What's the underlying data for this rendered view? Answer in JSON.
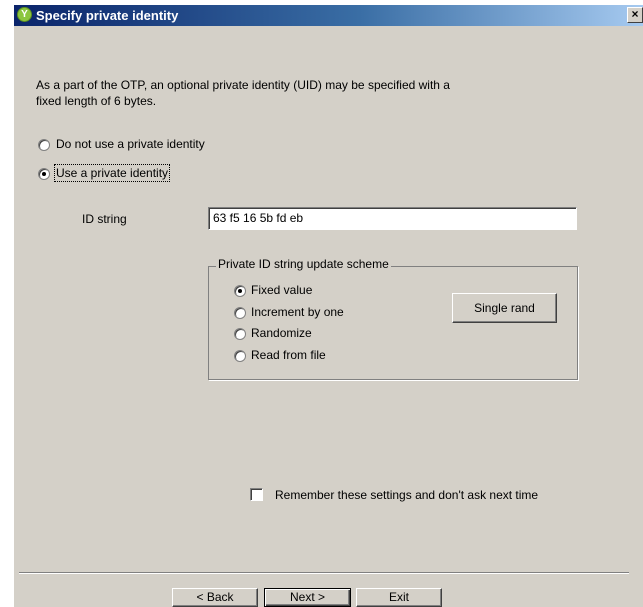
{
  "window": {
    "title": "Specify private identity",
    "app_icon": "yubico-icon",
    "close_glyph": "×"
  },
  "intro": {
    "line1": "As a part of the OTP, an optional private identity (UID) may be specified with a",
    "line2": "fixed length of 6 bytes."
  },
  "identity_options": [
    {
      "label": "Do not use a private identity",
      "selected": false
    },
    {
      "label": "Use a private identity",
      "selected": true
    }
  ],
  "id_string": {
    "label": "ID string",
    "value": "63 f5 16 5b fd eb"
  },
  "update_scheme": {
    "title": "Private ID string update scheme",
    "options": [
      {
        "label": "Fixed value",
        "selected": true
      },
      {
        "label": "Increment by one",
        "selected": false
      },
      {
        "label": "Randomize",
        "selected": false
      },
      {
        "label": "Read from file",
        "selected": false
      }
    ],
    "single_rand_label": "Single rand"
  },
  "remember": {
    "label": "Remember these settings and don't ask next time",
    "checked": false
  },
  "footer": {
    "back_label": "< Back",
    "next_label": "Next >",
    "exit_label": "Exit"
  }
}
